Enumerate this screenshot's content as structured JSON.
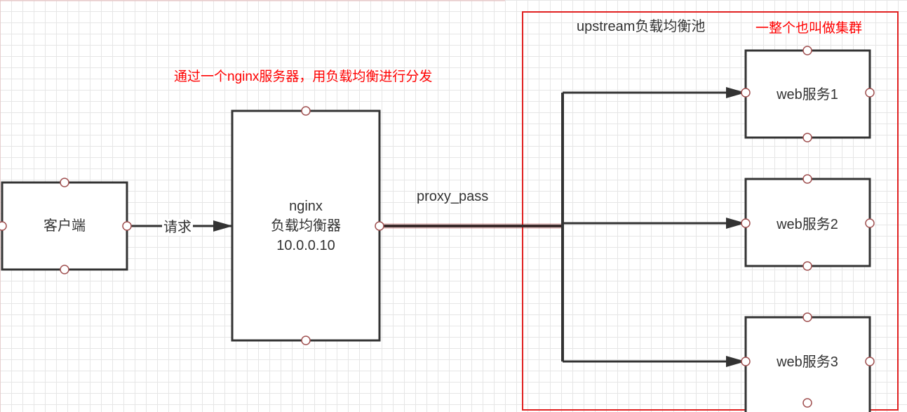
{
  "annotations": {
    "main_note": "通过一个nginx服务器，用负载均衡进行分发",
    "cluster_note": "一整个也叫做集群",
    "pool_title": "upstream负载均衡池",
    "colors": {
      "annotation": "#ff0000",
      "cluster_frame": "#e02020",
      "node_border": "#333333",
      "connector": "#b03030"
    }
  },
  "nodes": {
    "client": {
      "label": "客户端"
    },
    "nginx": {
      "label": "nginx\n负载均衡器\n10.0.0.10"
    },
    "web1": {
      "label": "web服务1"
    },
    "web2": {
      "label": "web服务2"
    },
    "web3": {
      "label": "web服务3"
    }
  },
  "edges": {
    "request": {
      "label": "请求"
    },
    "proxy": {
      "label": "proxy_pass"
    }
  }
}
